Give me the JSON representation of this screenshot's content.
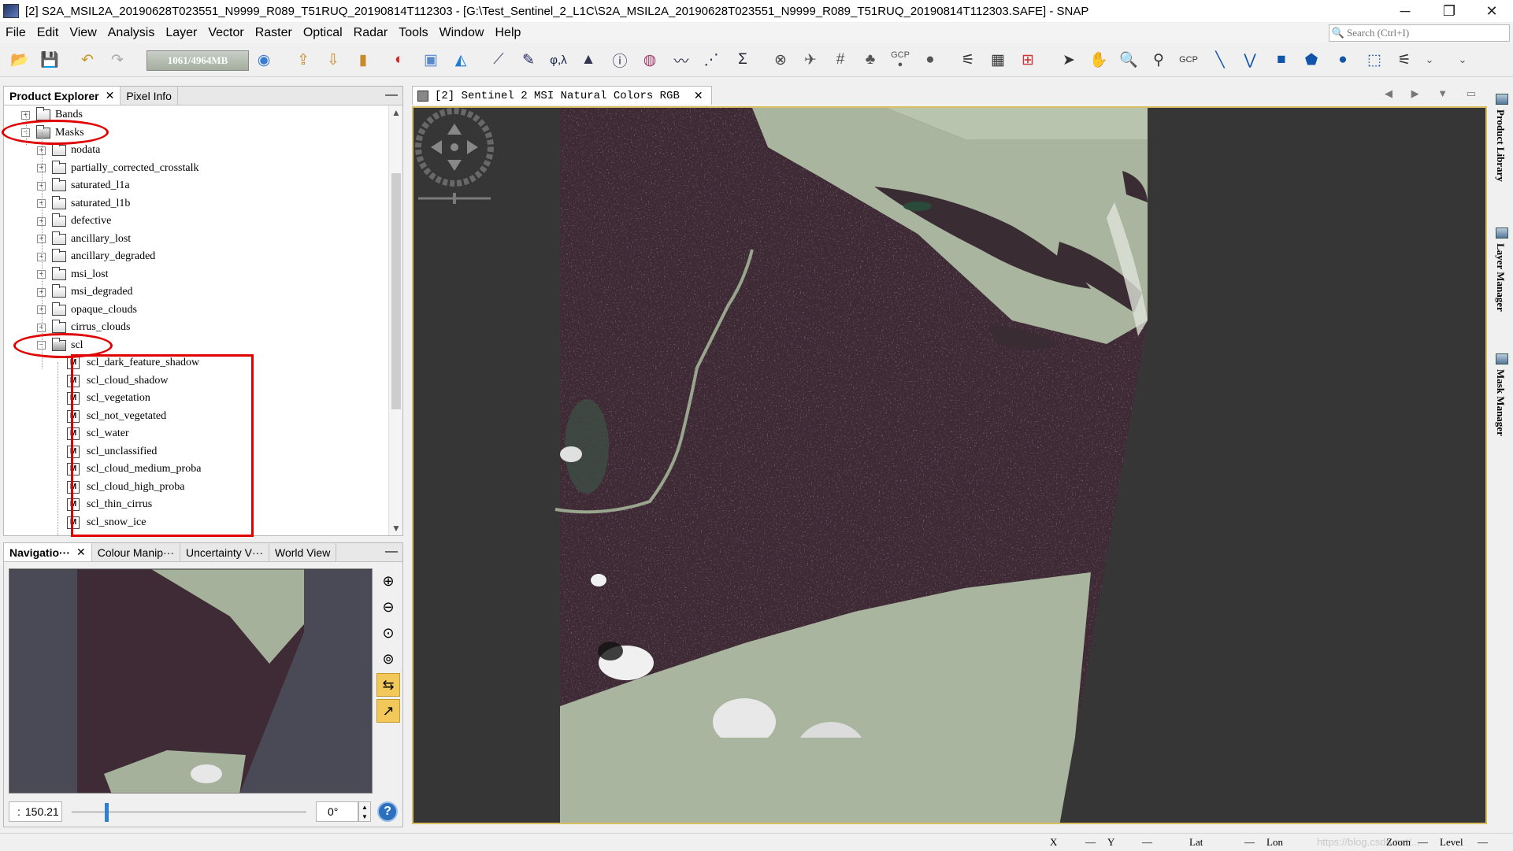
{
  "window": {
    "title": "[2] S2A_MSIL2A_20190628T023551_N9999_R089_T51RUQ_20190814T112303 - [G:\\Test_Sentinel_2_L1C\\S2A_MSIL2A_20190628T023551_N9999_R089_T51RUQ_20190814T112303.SAFE] - SNAP",
    "minimize": "─",
    "restore": "❐",
    "close": "✕"
  },
  "menu": [
    "File",
    "Edit",
    "View",
    "Analysis",
    "Layer",
    "Vector",
    "Raster",
    "Optical",
    "Radar",
    "Tools",
    "Window",
    "Help"
  ],
  "search": {
    "placeholder": "Search (Ctrl+I)"
  },
  "toolbar": {
    "memory": "1061/4964MB",
    "icons": [
      "open-product-icon",
      "save-product-icon",
      "undo-icon",
      "redo-icon",
      "world-map-icon",
      "import-raster-icon",
      "export-raster-icon",
      "band-maths-icon",
      "rgb-image-icon",
      "reproject-icon",
      "spectrum-icon",
      "mask-tool-icon",
      "phi-lambda-icon",
      "histogram-icon",
      "information-icon",
      "scatter-plot-icon",
      "profile-plot-icon",
      "correlative-plot-icon",
      "sigma-statistics-icon",
      "geometry-icon",
      "pin-icon",
      "graticule-icon",
      "gcp-manager-icon",
      "gcp-label",
      "overlay-icon",
      "band-table-icon",
      "grid-icon",
      "rgb-view-icon",
      "select-tool-icon",
      "pan-tool-icon",
      "zoom-tool-icon",
      "pin-placing-icon",
      "gcp-tool-icon",
      "line-tool-icon",
      "polyline-tool-icon",
      "rectangle-tool-icon",
      "polygon-tool-icon",
      "ellipse-tool-icon",
      "range-finder-icon",
      "magic-wand-icon",
      "more-icon"
    ],
    "gcp_label": "GCP"
  },
  "product_explorer": {
    "tabs": [
      "Product Explorer",
      "Pixel Info"
    ],
    "tree": [
      {
        "label": "Bands",
        "level": 1,
        "type": "folder",
        "expanded": false
      },
      {
        "label": "Masks",
        "level": 1,
        "type": "folder",
        "expanded": true
      },
      {
        "label": "nodata",
        "level": 2,
        "type": "folder",
        "expanded": false
      },
      {
        "label": "partially_corrected_crosstalk",
        "level": 2,
        "type": "folder",
        "expanded": false
      },
      {
        "label": "saturated_l1a",
        "level": 2,
        "type": "folder",
        "expanded": false
      },
      {
        "label": "saturated_l1b",
        "level": 2,
        "type": "folder",
        "expanded": false
      },
      {
        "label": "defective",
        "level": 2,
        "type": "folder",
        "expanded": false
      },
      {
        "label": "ancillary_lost",
        "level": 2,
        "type": "folder",
        "expanded": false
      },
      {
        "label": "ancillary_degraded",
        "level": 2,
        "type": "folder",
        "expanded": false
      },
      {
        "label": "msi_lost",
        "level": 2,
        "type": "folder",
        "expanded": false
      },
      {
        "label": "msi_degraded",
        "level": 2,
        "type": "folder",
        "expanded": false
      },
      {
        "label": "opaque_clouds",
        "level": 2,
        "type": "folder",
        "expanded": false
      },
      {
        "label": "cirrus_clouds",
        "level": 2,
        "type": "folder",
        "expanded": false
      },
      {
        "label": "scl",
        "level": 2,
        "type": "folder",
        "expanded": true
      },
      {
        "label": "scl_dark_feature_shadow",
        "level": 3,
        "type": "mask"
      },
      {
        "label": "scl_cloud_shadow",
        "level": 3,
        "type": "mask"
      },
      {
        "label": "scl_vegetation",
        "level": 3,
        "type": "mask"
      },
      {
        "label": "scl_not_vegetated",
        "level": 3,
        "type": "mask"
      },
      {
        "label": "scl_water",
        "level": 3,
        "type": "mask"
      },
      {
        "label": "scl_unclassified",
        "level": 3,
        "type": "mask"
      },
      {
        "label": "scl_cloud_medium_proba",
        "level": 3,
        "type": "mask"
      },
      {
        "label": "scl_cloud_high_proba",
        "level": 3,
        "type": "mask"
      },
      {
        "label": "scl_thin_cirrus",
        "level": 3,
        "type": "mask"
      },
      {
        "label": "scl_snow_ice",
        "level": 3,
        "type": "mask"
      }
    ]
  },
  "navigation": {
    "tabs": [
      "Navigatio···",
      "Colour Manip···",
      "Uncertainty V···",
      "World View"
    ],
    "zoom_value": "150.21",
    "zoom_prefix": ":",
    "rotation": "0°",
    "help": "?"
  },
  "image_view": {
    "tab_title": "[2] Sentinel 2 MSI Natural Colors RGB",
    "nav_arrows": "◀ ▶ ▼ ▭"
  },
  "right_sidebar": [
    "Product Library",
    "Layer Manager",
    "Mask Manager"
  ],
  "status_bar": {
    "x_label": "X",
    "x_value": "—",
    "y_label": "Y",
    "y_value": "—",
    "lat_label": "Lat",
    "lat_value": "—",
    "lon_label": "Lon",
    "zoom_label": "Zoom",
    "zoom_value": "—",
    "level_label": "Level",
    "level_value": "—",
    "watermark": "https://blog.csdn.net/..."
  },
  "colors": {
    "annotation_red": "#e00000",
    "canvas_bg": "#363636",
    "land": "#3e2a35",
    "water": "#a9b59e",
    "view_border": "#d6be61",
    "accent": "#2b6fbf"
  }
}
